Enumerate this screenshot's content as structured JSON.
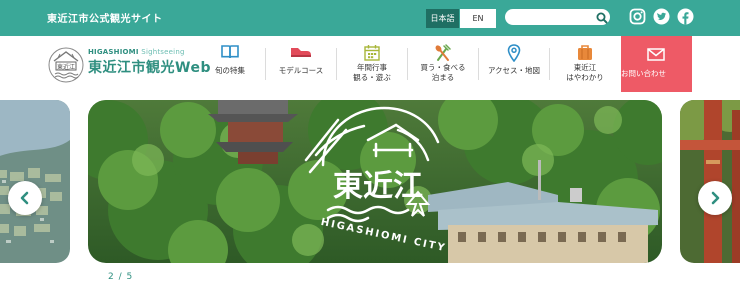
{
  "topbar": {
    "site_title": "東近江市公式観光サイト",
    "lang_ja": "日本語",
    "lang_en": "EN",
    "search_placeholder": ""
  },
  "header": {
    "logo_sub_bold": "HIGASHIOMI",
    "logo_sub_light": "Sightseeing",
    "logo_main": "東近江市観光Web"
  },
  "nav": [
    {
      "label": "旬の特集",
      "icon": "book-icon"
    },
    {
      "label": "モデルコース",
      "icon": "shoe-icon"
    },
    {
      "label": "年間行事\n観る・遊ぶ",
      "icon": "calendar-icon"
    },
    {
      "label": "買う・食べる\n泊まる",
      "icon": "fork-spoon-icon"
    },
    {
      "label": "アクセス・地図",
      "icon": "map-pin-icon"
    },
    {
      "label": "東近江\nはやわかり",
      "icon": "suitcase-icon"
    }
  ],
  "contact": {
    "label": "お問い合わせ",
    "icon": "mail-icon"
  },
  "slider": {
    "logo_text": "東近江",
    "logo_roman": "HIGASHIOMI CITY",
    "pager": "2 / 5"
  },
  "colors": {
    "brand": "#3aa898",
    "brand_dark": "#1f6f63",
    "contact": "#ee5a66"
  }
}
